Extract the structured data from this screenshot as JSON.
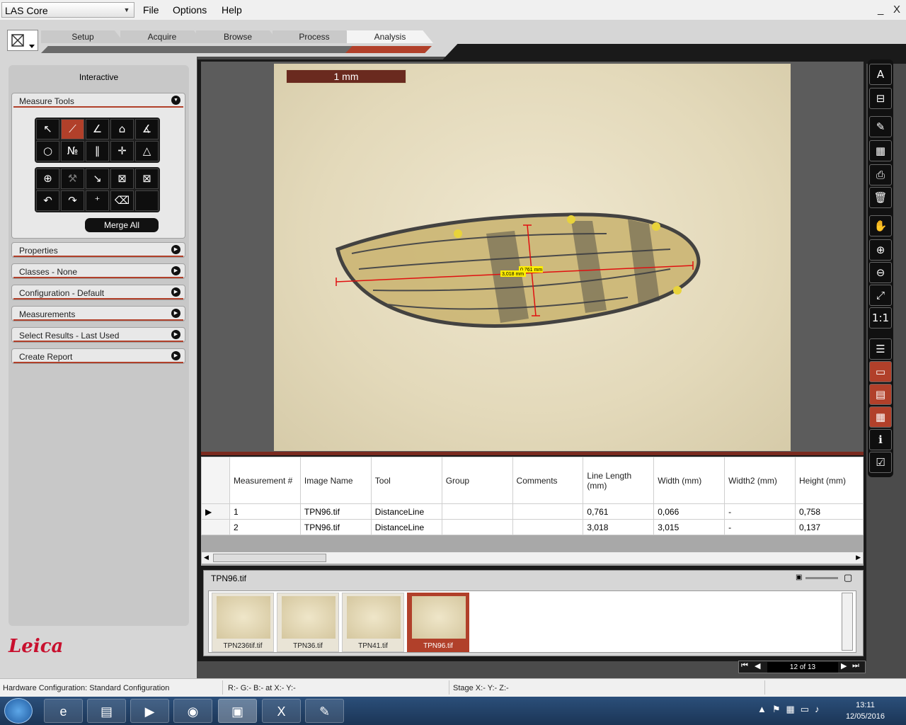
{
  "app": {
    "name": "LAS Core"
  },
  "menu": {
    "file": "File",
    "options": "Options",
    "help": "Help"
  },
  "window": {
    "minimize": "_",
    "close": "X"
  },
  "tabs": [
    {
      "label": "Setup"
    },
    {
      "label": "Acquire"
    },
    {
      "label": "Browse"
    },
    {
      "label": "Process"
    },
    {
      "label": "Analysis"
    }
  ],
  "left": {
    "title": "Interactive",
    "measure_tools": "Measure Tools",
    "merge_all": "Merge All",
    "sections": [
      {
        "label": "Properties"
      },
      {
        "label": "Classes - None"
      },
      {
        "label": "Configuration - Default"
      },
      {
        "label": "Measurements"
      },
      {
        "label": "Select Results - Last Used"
      },
      {
        "label": "Create Report"
      }
    ],
    "logo": "Leica"
  },
  "viewer": {
    "scale_bar": "1 mm",
    "label1": "0,761 mm",
    "label2": "3,018 mm"
  },
  "table": {
    "headers": [
      "Measurement #",
      "Image Name",
      "Tool",
      "Group",
      "Comments",
      "Line Length (mm)",
      "Width (mm)",
      "Width2 (mm)",
      "Height (mm)"
    ],
    "rows": [
      [
        "1",
        "TPN96.tif",
        "DistanceLine",
        "",
        "",
        "0,761",
        "0,066",
        "-",
        "0,758"
      ],
      [
        "2",
        "TPN96.tif",
        "DistanceLine",
        "",
        "",
        "3,018",
        "3,015",
        "-",
        "0,137"
      ]
    ]
  },
  "gallery": {
    "title": "TPN96.tif",
    "items": [
      {
        "caption": "TPN236tif.tif"
      },
      {
        "caption": "TPN36.tif"
      },
      {
        "caption": "TPN41.tif"
      },
      {
        "caption": "TPN96.tif"
      }
    ]
  },
  "nav": {
    "count": "12 of 13"
  },
  "status": {
    "hardware": "Hardware Configuration: Standard Configuration",
    "rgb": "R:-  G:-  B:-  at  X:-  Y:-",
    "stage": "Stage X:-  Y:-  Z:-"
  },
  "clock": {
    "time": "13:11",
    "date": "12/05/2016"
  },
  "colors": {
    "accent": "#b1402a",
    "measure_line": "#e01010",
    "label_bg": "#ffee00"
  }
}
